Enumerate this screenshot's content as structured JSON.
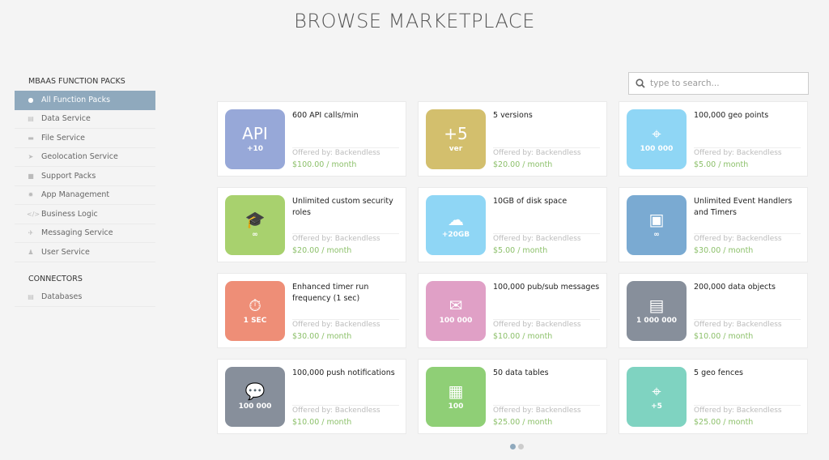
{
  "title": "BROWSE MARKETPLACE",
  "sidebar": {
    "section1": "MBAAS FUNCTION PACKS",
    "items": [
      {
        "label": "All Function Packs",
        "icon": "●",
        "active": true
      },
      {
        "label": "Data Service",
        "icon": "▤"
      },
      {
        "label": "File Service",
        "icon": "▬"
      },
      {
        "label": "Geolocation Service",
        "icon": "➤"
      },
      {
        "label": "Support Packs",
        "icon": "■"
      },
      {
        "label": "App Management",
        "icon": "✹"
      },
      {
        "label": "Business Logic",
        "icon": "</>"
      },
      {
        "label": "Messaging Service",
        "icon": "✈"
      },
      {
        "label": "User Service",
        "icon": "♟"
      }
    ],
    "section2": "CONNECTORS",
    "connectors": [
      {
        "label": "Databases",
        "icon": "▤"
      }
    ]
  },
  "search": {
    "placeholder": "type to search..."
  },
  "cards": [
    {
      "name": "600 API calls/min",
      "by": "Offered by: Backendless",
      "price": "$100.00 / month",
      "color": "#97a8d8",
      "glyph": "API",
      "caption": "+10"
    },
    {
      "name": "5 versions",
      "by": "Offered by: Backendless",
      "price": "$20.00 / month",
      "color": "#d3bf6d",
      "glyph": "+5",
      "caption": "ver"
    },
    {
      "name": "100,000 geo points",
      "by": "Offered by: Backendless",
      "price": "$5.00 / month",
      "color": "#8fd6f5",
      "glyph": "⌖",
      "caption": "100 000"
    },
    {
      "name": "Unlimited custom security roles",
      "by": "Offered by: Backendless",
      "price": "$20.00 / month",
      "color": "#a8d16e",
      "glyph": "🎓",
      "caption": "∞"
    },
    {
      "name": "10GB of disk space",
      "by": "Offered by: Backendless",
      "price": "$5.00 / month",
      "color": "#8fd6f5",
      "glyph": "☁",
      "caption": "+20GB"
    },
    {
      "name": "Unlimited Event Handlers and Timers",
      "by": "Offered by: Backendless",
      "price": "$30.00 / month",
      "color": "#7aaad2",
      "glyph": "▣",
      "caption": "∞"
    },
    {
      "name": "Enhanced timer run frequency (1 sec)",
      "by": "Offered by: Backendless",
      "price": "$30.00 / month",
      "color": "#ee8e77",
      "glyph": "⏱",
      "caption": "1 SEC"
    },
    {
      "name": "100,000 pub/sub messages",
      "by": "Offered by: Backendless",
      "price": "$10.00 / month",
      "color": "#e0a0c6",
      "glyph": "✉",
      "caption": "100 000"
    },
    {
      "name": "200,000 data objects",
      "by": "Offered by: Backendless",
      "price": "$10.00 / month",
      "color": "#878f9b",
      "glyph": "▤",
      "caption": "1 000 000"
    },
    {
      "name": "100,000 push notifications",
      "by": "Offered by: Backendless",
      "price": "$10.00 / month",
      "color": "#878f9b",
      "glyph": "💬",
      "caption": "100 000"
    },
    {
      "name": "50 data tables",
      "by": "Offered by: Backendless",
      "price": "$25.00 / month",
      "color": "#8fcf76",
      "glyph": "▦",
      "caption": "100"
    },
    {
      "name": "5 geo fences",
      "by": "Offered by: Backendless",
      "price": "$25.00 / month",
      "color": "#7fd3c1",
      "glyph": "⌖",
      "caption": "+5"
    }
  ]
}
